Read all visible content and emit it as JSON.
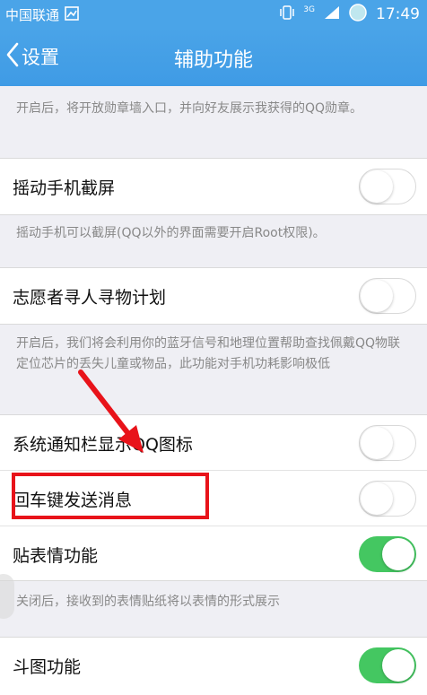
{
  "status_bar": {
    "carrier": "中国联通",
    "network": "3G",
    "time": "17:49"
  },
  "nav": {
    "back_label": "设置",
    "title": "辅助功能"
  },
  "descriptions": {
    "medal": "开启后，将开放勋章墙入口，并向好友展示我获得的QQ勋章。",
    "shake": "摇动手机可以截屏(QQ以外的界面需要开启Root权限)。",
    "volunteer": "开启后，我们将会利用你的蓝牙信号和地理位置帮助查找佩戴QQ物联定位芯片的丢失儿童或物品，此功能对手机功耗影响极低",
    "sticker": "关闭后，接收到的表情贴纸将以表情的形式展示"
  },
  "settings": [
    {
      "label": "摇动手机截屏",
      "on": false
    },
    {
      "label": "志愿者寻人寻物计划",
      "on": false
    },
    {
      "label": "系统通知栏显示QQ图标",
      "on": false
    },
    {
      "label": "回车键发送消息",
      "on": false
    },
    {
      "label": "贴表情功能",
      "on": true
    },
    {
      "label": "斗图功能",
      "on": true
    }
  ],
  "colors": {
    "header": "#4aa4e8",
    "switch_on": "#44c761",
    "annotation": "#e8131a"
  }
}
